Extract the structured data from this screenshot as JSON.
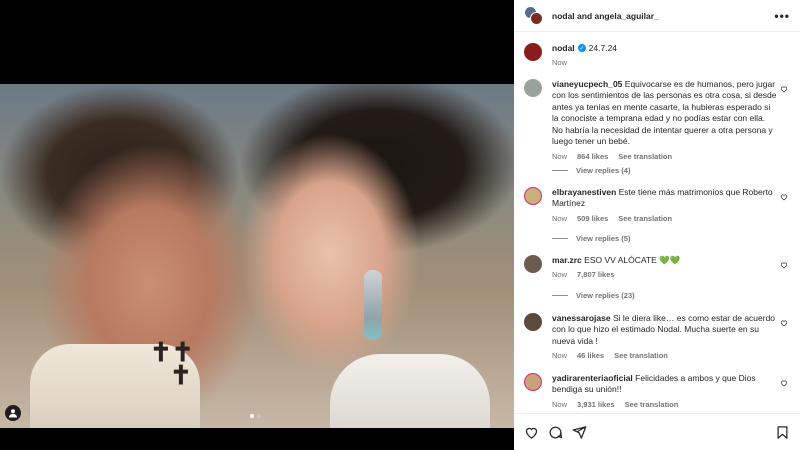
{
  "header": {
    "names": "nodal and angela_aguilar_"
  },
  "caption": {
    "username": "nodal",
    "text": "24.7.24",
    "time": "Now"
  },
  "comments": [
    {
      "username": "vianeyucpech_05",
      "text": "Equivocarse es de humanos, pero jugar con los sentimientos de las personas es otra cosa, si desde antes ya tenías en mente casarte, la hubieras esperado si la conociste a temprana edad y no podías estar con ella. No habría la necesidad de intentar querer a otra persona y luego tener un bebé.",
      "time": "Now",
      "likes": "864 likes",
      "translate": "See translation",
      "replies": "View replies (4)",
      "avatar_color": "#9aa39b"
    },
    {
      "username": "elbrayanestiven",
      "text": "Este tiene más matrimonios que Roberto Martínez",
      "time": "Now",
      "likes": "509 likes",
      "translate": "See translation",
      "replies": "View replies (5)",
      "avatar_color": "#c9b07a"
    },
    {
      "username": "mar.zrc",
      "text": "ESO VV ALÓCATE 💚💚",
      "time": "Now",
      "likes": "7,807 likes",
      "translate": "",
      "replies": "View replies (23)",
      "avatar_color": "#6d5a4e"
    },
    {
      "username": "vanessarojase",
      "text": "Si le diera like… es como estar de acuerdo con lo que hizo el estimado Nodal. Mucha suerte en su nueva vida !",
      "time": "Now",
      "likes": "46 likes",
      "translate": "See translation",
      "replies": "",
      "avatar_color": "#5c4a3e"
    },
    {
      "username": "yadirarenteriaoficial",
      "text": "Felicidades a ambos y que Dios bendiga su unión!!",
      "time": "Now",
      "likes": "3,931 likes",
      "translate": "See translation",
      "replies": "",
      "avatar_color": "#c8a27a"
    }
  ],
  "icons": [
    "heart-icon",
    "comment-icon",
    "share-icon",
    "save-icon",
    "more-icon",
    "verified-icon",
    "user-tag-icon"
  ],
  "carousel": {
    "count": 2,
    "active": 1
  }
}
